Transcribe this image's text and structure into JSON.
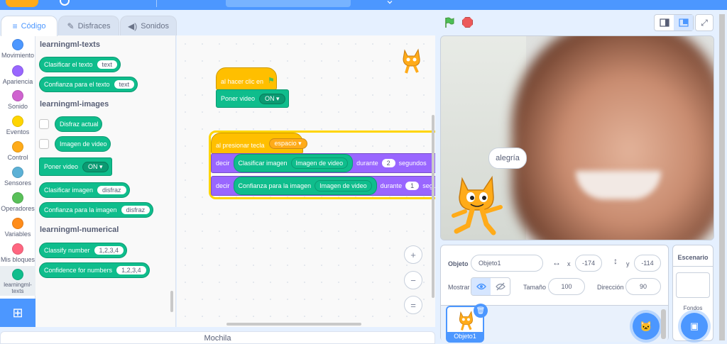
{
  "tabs": [
    {
      "label": "Código",
      "icon": "code-icon"
    },
    {
      "label": "Disfraces",
      "icon": "brush-icon"
    },
    {
      "label": "Sonidos",
      "icon": "speaker-icon"
    }
  ],
  "categories": [
    {
      "label": "Movimiento",
      "color": "#4c97ff"
    },
    {
      "label": "Apariencia",
      "color": "#9966ff"
    },
    {
      "label": "Sonido",
      "color": "#cf63cf"
    },
    {
      "label": "Eventos",
      "color": "#ffd500"
    },
    {
      "label": "Control",
      "color": "#ffab19"
    },
    {
      "label": "Sensores",
      "color": "#5cb1d6"
    },
    {
      "label": "Operadores",
      "color": "#59c059"
    },
    {
      "label": "Variables",
      "color": "#ff8c1a"
    },
    {
      "label": "Mis bloques",
      "color": "#ff6680"
    },
    {
      "label": "learningml-texts",
      "color": "#0fbd8c"
    }
  ],
  "palette": {
    "sections": [
      "learningml-texts",
      "learningml-images",
      "learningml-numerical"
    ],
    "blocks": {
      "classify_text": {
        "label": "Clasificar el texto",
        "arg": "text"
      },
      "confidence_text": {
        "label": "Confianza para el texto",
        "arg": "text"
      },
      "costume": {
        "label": "Disfraz actual"
      },
      "video_image": {
        "label": "Imagen de video"
      },
      "set_video": {
        "label": "Poner video",
        "arg": "ON"
      },
      "classify_image": {
        "label": "Clasificar imagen",
        "arg": "disfraz"
      },
      "confidence_image": {
        "label": "Confianza para la imagen",
        "arg": "disfraz"
      },
      "classify_number": {
        "label": "Classify number",
        "arg": "1,2,3,4"
      },
      "confidence_numbers": {
        "label": "Confidence for numbers",
        "arg": "1,2,3,4"
      }
    }
  },
  "script": {
    "hat1": {
      "label": "al hacer clic en"
    },
    "set_video": {
      "label": "Poner video",
      "arg": "ON"
    },
    "hat2": {
      "label": "al presionar tecla",
      "arg": "espacio"
    },
    "say1": {
      "say": "decir",
      "reporter": "Clasificar imagen",
      "inner": "Imagen de video",
      "duration_label": "durante",
      "secs": "2",
      "unit": "segundos"
    },
    "say2": {
      "say": "decir",
      "reporter": "Confianza para la imagen",
      "inner": "Imagen de video",
      "duration_label": "durante",
      "secs": "1",
      "unit": "segundos"
    }
  },
  "zoom": {
    "in": "+",
    "out": "−",
    "reset": "="
  },
  "backpack": {
    "label": "Mochila"
  },
  "stage": {
    "speech": "alegría"
  },
  "sprite_info": {
    "objeto_label": "Objeto",
    "name": "Objeto1",
    "x_label": "x",
    "x": "-174",
    "y_label": "y",
    "y": "-114",
    "mostrar_label": "Mostrar",
    "tamano_label": "Tamaño",
    "size": "100",
    "direccion_label": "Dirección",
    "direction": "90"
  },
  "sprite_tile": {
    "name": "Objeto1"
  },
  "stage_pane": {
    "title": "Escenario",
    "backdrops_label": "Fondos"
  }
}
